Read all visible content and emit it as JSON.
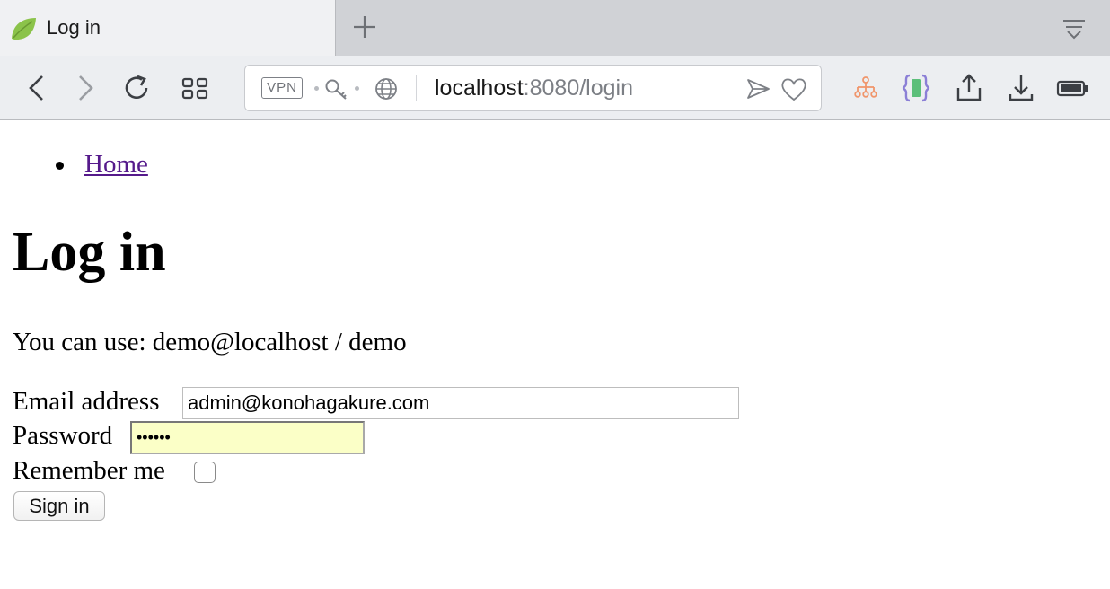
{
  "browser": {
    "tab_title": "Log in",
    "url_host": "localhost",
    "url_path": ":8080/login",
    "vpn_label": "VPN",
    "colors": {
      "favicon": "#8bc34a",
      "extension_orange": "#f0956b",
      "extension_purple": "#8b7fd6"
    }
  },
  "page": {
    "nav": [
      {
        "label": "Home"
      }
    ],
    "heading": "Log in",
    "hint": "You can use: demo@localhost / demo",
    "form": {
      "email_label": "Email address",
      "email_value": "admin@konohagakure.com",
      "password_label": "Password",
      "password_value": "••••••",
      "remember_label": "Remember me",
      "remember_checked": false,
      "submit_label": "Sign in"
    }
  }
}
